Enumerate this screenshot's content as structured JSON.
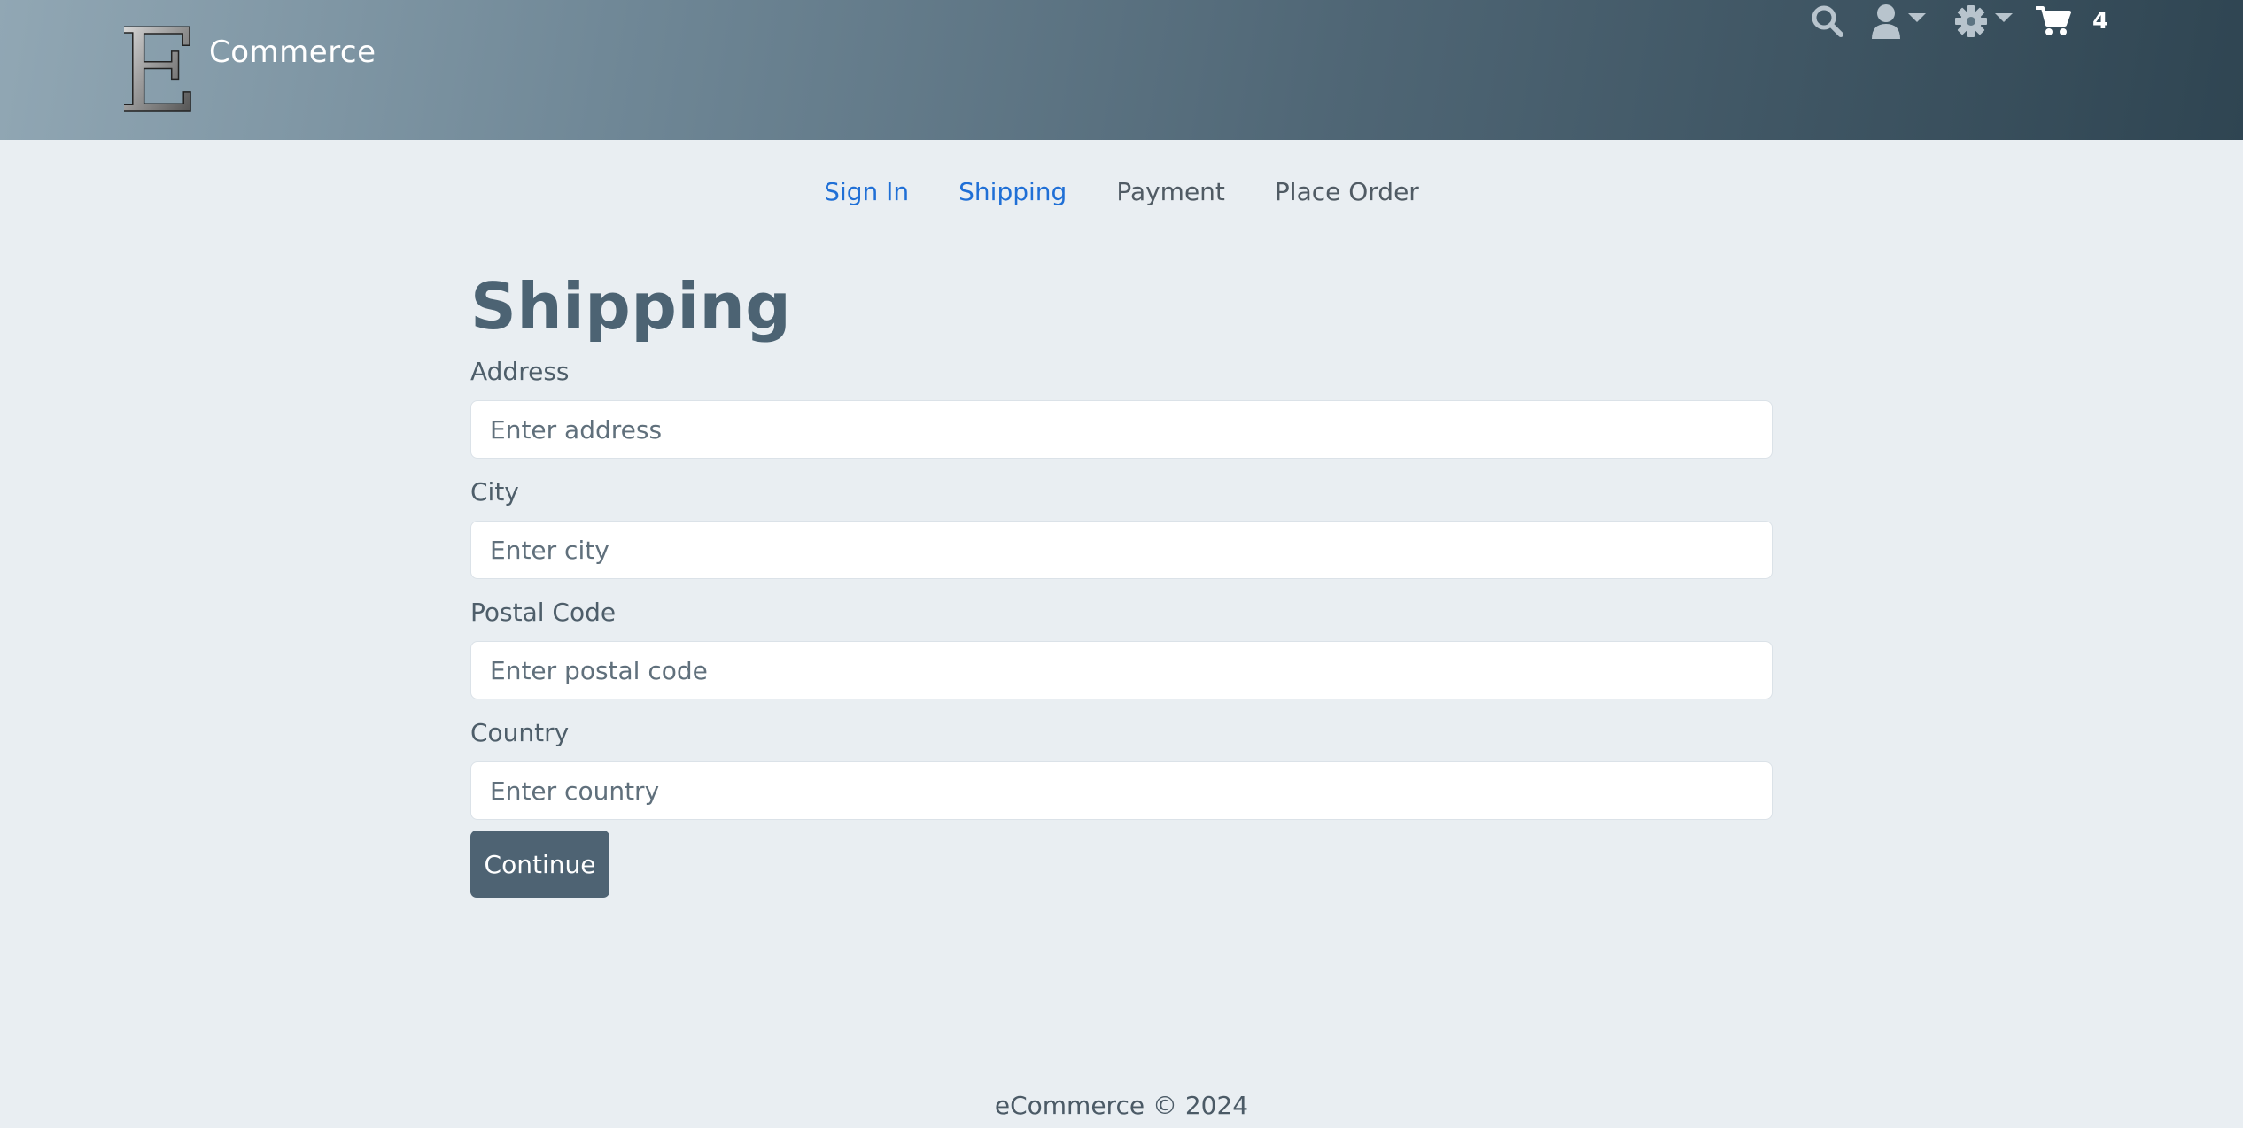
{
  "brand": {
    "logo_letter": "E",
    "name": "Commerce"
  },
  "header": {
    "icons": [
      "search-icon",
      "user-icon",
      "gear-icon",
      "cart-icon"
    ],
    "cart_count": "4"
  },
  "steps": [
    {
      "label": "Sign In",
      "state": "enabled"
    },
    {
      "label": "Shipping",
      "state": "enabled"
    },
    {
      "label": "Payment",
      "state": "disabled"
    },
    {
      "label": "Place Order",
      "state": "disabled"
    }
  ],
  "form": {
    "title": "Shipping",
    "fields": [
      {
        "label": "Address",
        "placeholder": "Enter address",
        "value": ""
      },
      {
        "label": "City",
        "placeholder": "Enter city",
        "value": ""
      },
      {
        "label": "Postal Code",
        "placeholder": "Enter postal code",
        "value": ""
      },
      {
        "label": "Country",
        "placeholder": "Enter country",
        "value": ""
      }
    ],
    "submit_label": "Continue"
  },
  "footer": {
    "text": "eCommerce © 2024"
  },
  "colors": {
    "header_gradient_start": "#91a7b4",
    "header_gradient_end": "#2f4552",
    "page_background": "#e9eef2",
    "active_step": "#1f6fd6",
    "button": "#4e6373"
  }
}
